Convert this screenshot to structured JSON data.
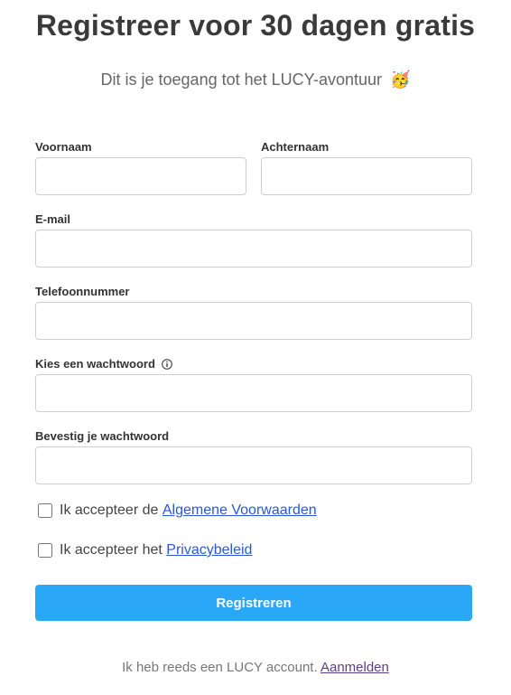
{
  "header": {
    "title": "Registreer voor 30 dagen gratis",
    "subtitle": "Dit is je toegang tot het LUCY-avontuur",
    "subtitle_emoji": "🥳"
  },
  "form": {
    "first_name": {
      "label": "Voornaam",
      "value": "",
      "placeholder": ""
    },
    "last_name": {
      "label": "Achternaam",
      "value": "",
      "placeholder": ""
    },
    "email": {
      "label": "E-mail",
      "value": "",
      "placeholder": ""
    },
    "phone": {
      "label": "Telefoonnummer",
      "value": "",
      "placeholder": ""
    },
    "password": {
      "label": "Kies een wachtwoord",
      "value": "",
      "placeholder": "",
      "info_icon": "info-circle-icon"
    },
    "confirm_password": {
      "label": "Bevestig je wachtwoord",
      "value": "",
      "placeholder": ""
    },
    "terms": {
      "prefix": "Ik accepteer de",
      "link_text": "Algemene Voorwaarden",
      "checked": false
    },
    "privacy": {
      "prefix": "Ik accepteer het",
      "link_text": "Privacybeleid",
      "checked": false
    },
    "submit_label": "Registreren"
  },
  "footer": {
    "text": "Ik heb reeds een LUCY account.",
    "link_text": "Aanmelden"
  },
  "colors": {
    "accent": "#2aa7f7",
    "link": "#2b57d6",
    "footer_link": "#5a3e8a"
  }
}
